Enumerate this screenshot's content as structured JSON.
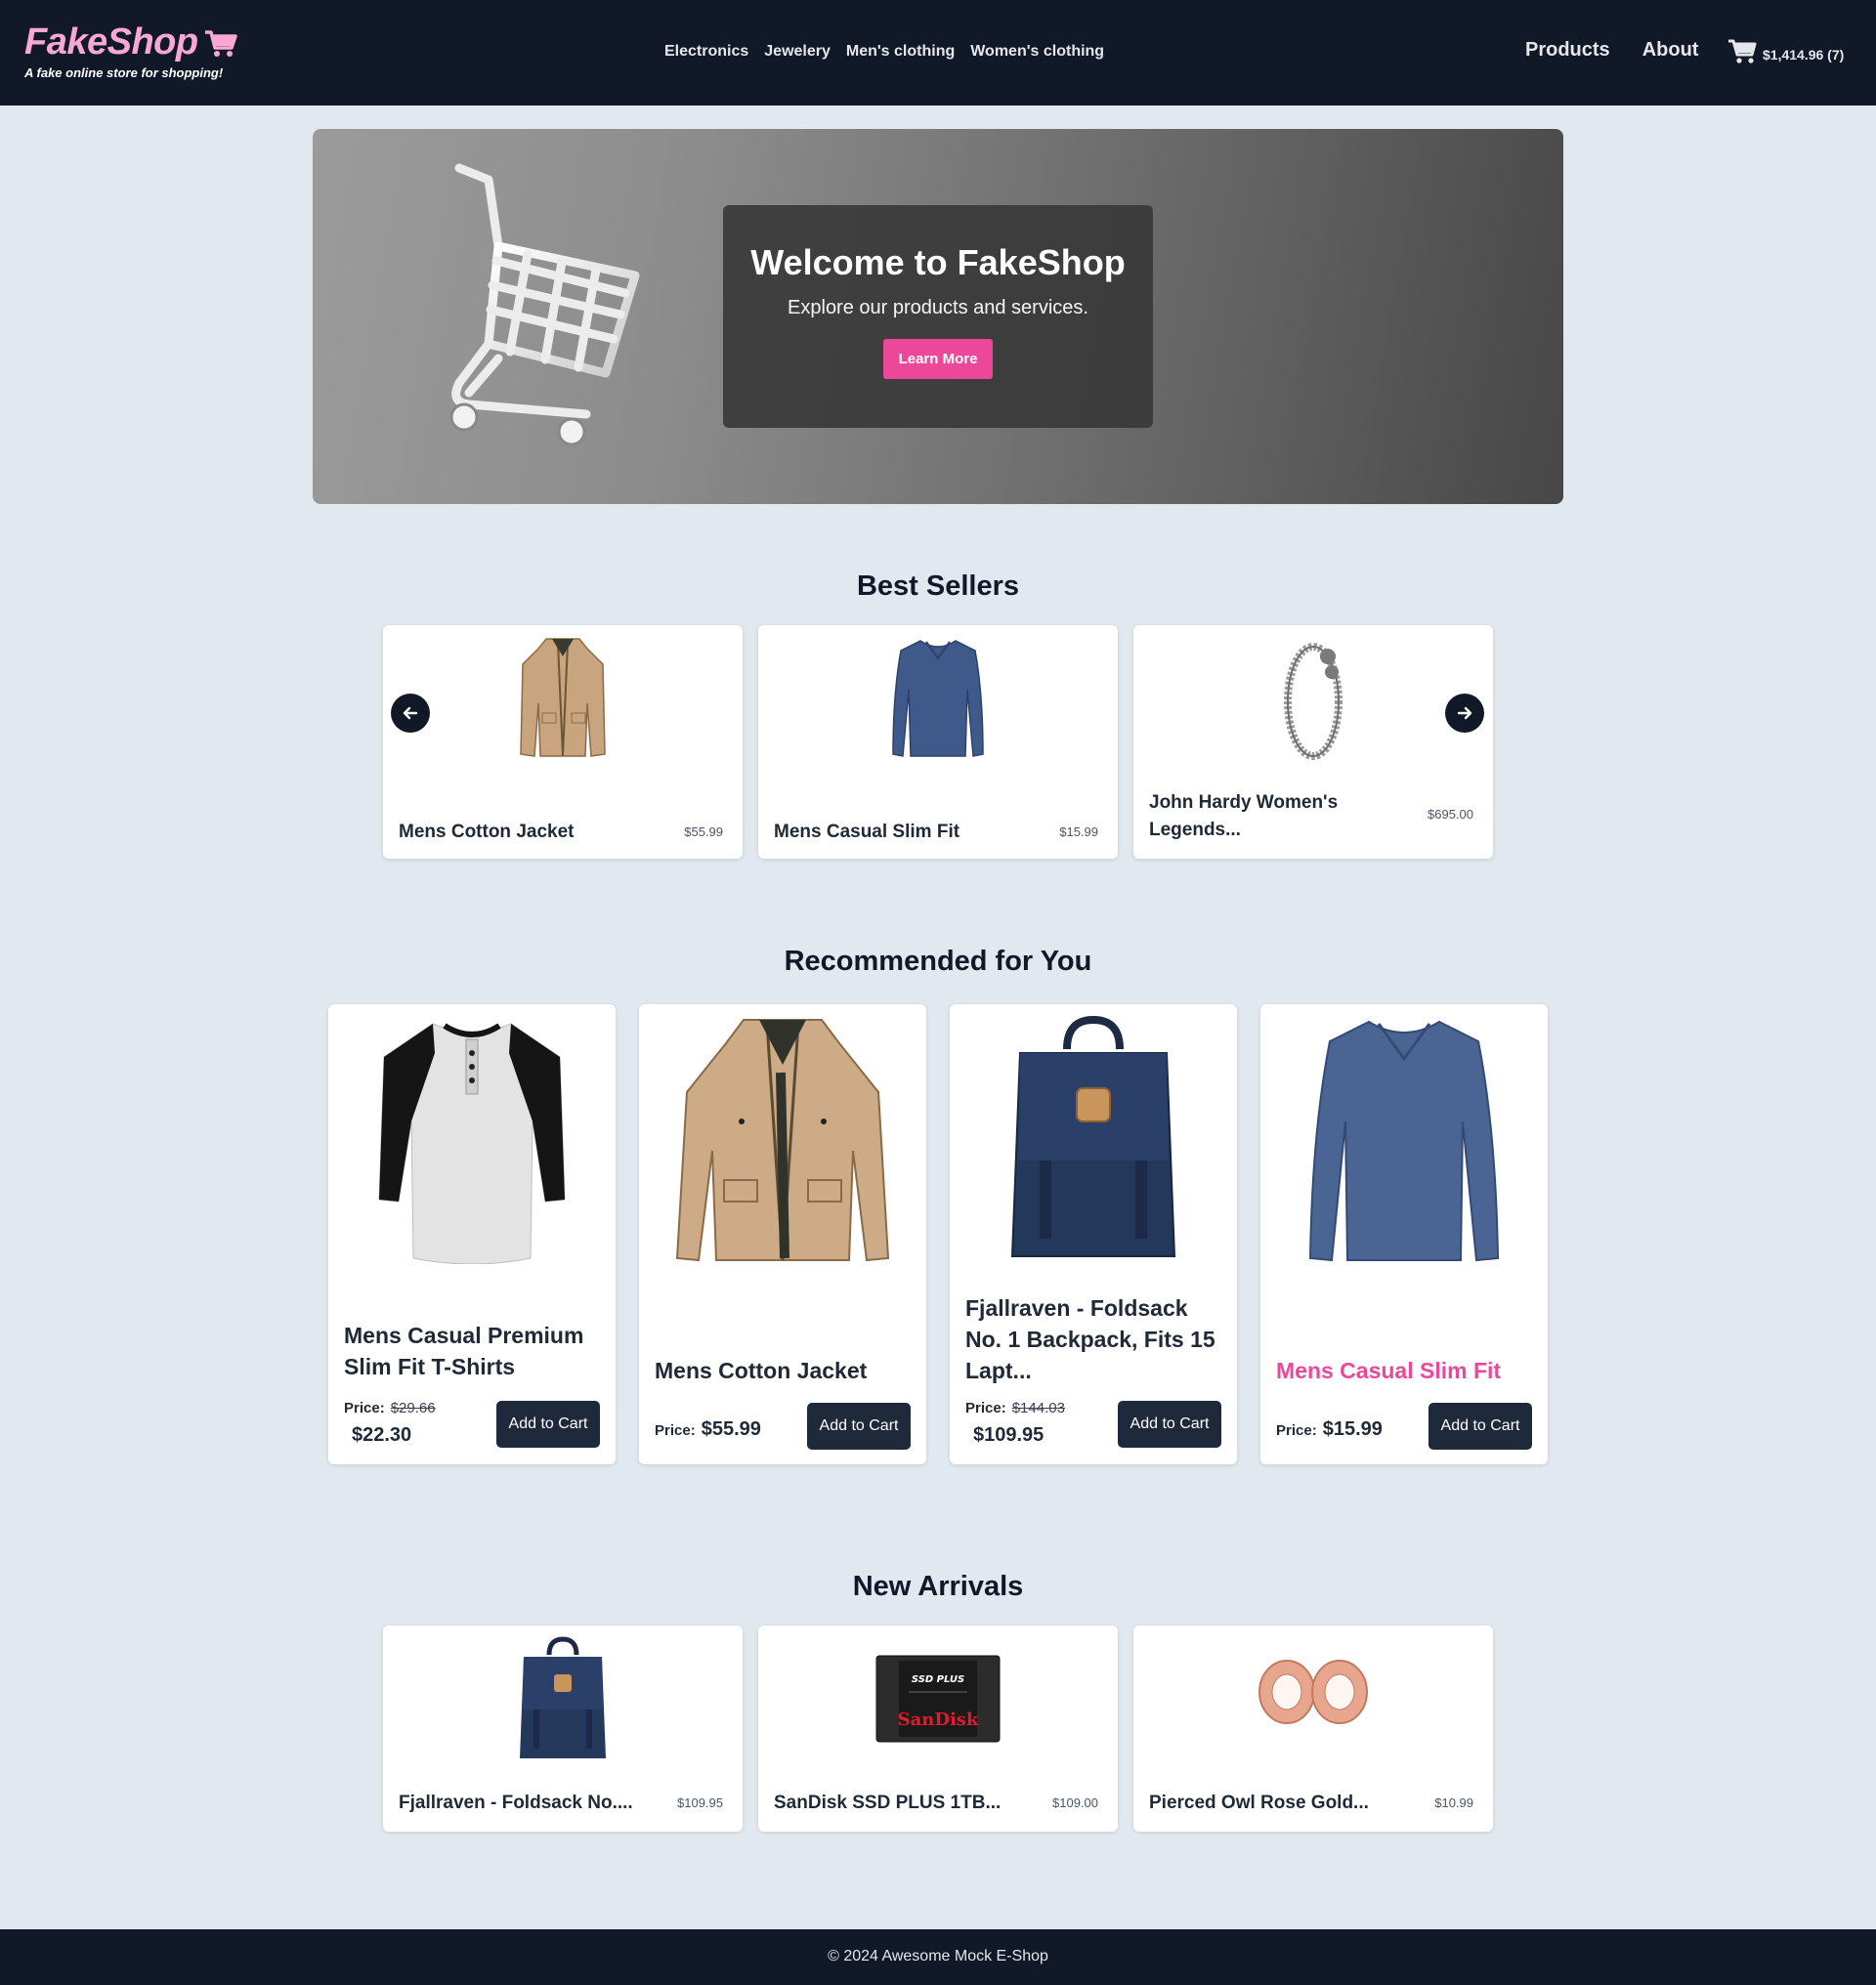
{
  "brand": {
    "name": "FakeShop",
    "tagline": "A fake online store for shopping!",
    "color": "#f9a8d4"
  },
  "nav": {
    "categories": [
      "Electronics",
      "Jewelery",
      "Men's clothing",
      "Women's clothing"
    ],
    "links": [
      "Products",
      "About"
    ],
    "cart_summary": "$1,414.96 (7)"
  },
  "hero": {
    "title": "Welcome to FakeShop",
    "subtitle": "Explore our products and services.",
    "button": "Learn More",
    "accent": "#ec4899"
  },
  "best_sellers": {
    "title": "Best Sellers",
    "items": [
      {
        "name": "Mens Cotton Jacket",
        "price": "$55.99",
        "icon": "jacket"
      },
      {
        "name": "Mens Casual Slim Fit",
        "price": "$15.99",
        "icon": "longsleeve"
      },
      {
        "name": "John Hardy Women's Legends...",
        "price": "$695.00",
        "icon": "bracelet"
      }
    ]
  },
  "recommended": {
    "title": "Recommended for You",
    "price_label": "Price:",
    "add_label": "Add to Cart",
    "items": [
      {
        "name": "Mens Casual Premium Slim Fit T-Shirts",
        "old_price": "$29.66",
        "price": "$22.30",
        "icon": "raglan-tee"
      },
      {
        "name": "Mens Cotton Jacket",
        "price": "$55.99",
        "icon": "jacket"
      },
      {
        "name": "Fjallraven - Foldsack No. 1 Backpack, Fits 15 Lapt...",
        "old_price": "$144.03",
        "price": "$109.95",
        "icon": "backpack"
      },
      {
        "name": "Mens Casual Slim Fit",
        "price": "$15.99",
        "icon": "longsleeve",
        "highlighted": true
      }
    ]
  },
  "new_arrivals": {
    "title": "New Arrivals",
    "items": [
      {
        "name": "Fjallraven - Foldsack No....",
        "price": "$109.95",
        "icon": "backpack"
      },
      {
        "name": "SanDisk SSD PLUS 1TB...",
        "price": "$109.00",
        "icon": "ssd",
        "ssd_label_top": "SSD PLUS",
        "ssd_label_brand": "SanDisk"
      },
      {
        "name": "Pierced Owl Rose Gold...",
        "price": "$10.99",
        "icon": "rose-gold-plugs"
      }
    ]
  },
  "footer": {
    "text": "© 2024 Awesome Mock E-Shop"
  }
}
